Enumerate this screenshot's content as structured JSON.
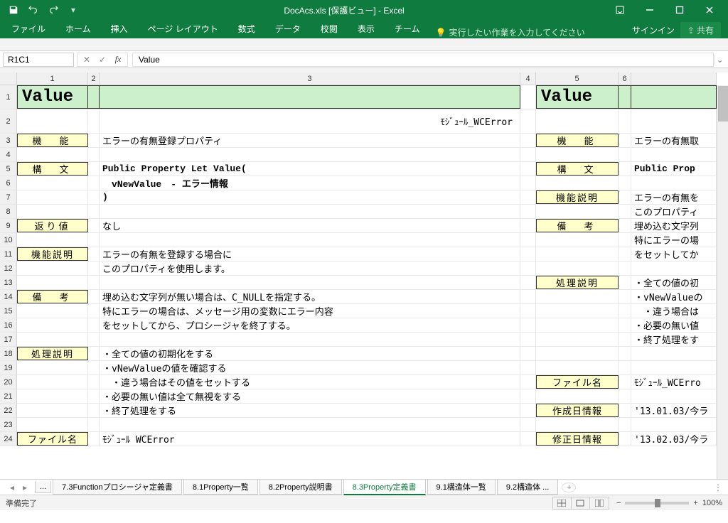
{
  "title": "DocAcs.xls  [保護ビュー] - Excel",
  "ribbon": {
    "tabs": [
      "ファイル",
      "ホーム",
      "挿入",
      "ページ レイアウト",
      "数式",
      "データ",
      "校閲",
      "表示",
      "チーム"
    ],
    "tellme": "実行したい作業を入力してください",
    "signin": "サインイン",
    "share": "共有"
  },
  "formula": {
    "namebox": "R1C1",
    "value": "Value"
  },
  "columns": [
    "1",
    "2",
    "3",
    "4",
    "5",
    "6"
  ],
  "rows": [
    "1",
    "2",
    "3",
    "4",
    "5",
    "6",
    "7",
    "8",
    "9",
    "10",
    "11",
    "12",
    "13",
    "14",
    "15",
    "16",
    "17",
    "18",
    "19",
    "20",
    "21",
    "22",
    "23",
    "24"
  ],
  "left": {
    "header": "Value",
    "module": "ﾓｼﾞｭｰﾙ_WCError",
    "labels": {
      "func": "機　能",
      "syntax": "構　文",
      "return": "返り値",
      "desc": "機能説明",
      "remark": "備　考",
      "process": "処理説明",
      "file": "ファイル名"
    },
    "content": {
      "func": "エラーの有無登録プロパティ",
      "syn1": "Public Property Let Value(",
      "syn2": "　vNewValue　- エラー情報",
      "syn3": ")",
      "ret": "なし",
      "d1": "エラーの有無を登録する場合に",
      "d2": "このプロパティを使用します。",
      "r1": "埋め込む文字列が無い場合は、C_NULLを指定する。",
      "r2": "特にエラーの場合は、メッセージ用の変数にエラー内容",
      "r3": "をセットしてから、プロシージャを終了する。",
      "p1": "・全ての値の初期化をする",
      "p2": "・vNewValueの値を確認する",
      "p3": "　・違う場合はその値をセットする",
      "p4": "・必要の無い値は全て無視をする",
      "p5": "・終了処理をする",
      "file": "ﾓｼﾞｭｰﾙ WCError"
    }
  },
  "right": {
    "header": "Value",
    "labels": {
      "func": "機　能",
      "syntax": "構　文",
      "desc": "機能説明",
      "remark": "備　考",
      "process": "処理説明",
      "file": "ファイル名",
      "create": "作成日情報",
      "modify": "修正日情報"
    },
    "content": {
      "func": "エラーの有無取",
      "syn": "Public Prop",
      "d1": "エラーの有無を",
      "d2": "このプロパティ",
      "r1": "埋め込む文字列",
      "r2": "特にエラーの場",
      "r3": "をセットしてか",
      "p1": "・全ての値の初",
      "p2": "・vNewValueの",
      "p3": "　・違う場合は",
      "p4": "・必要の無い値",
      "p5": "・終了処理をす",
      "file": "ﾓｼﾞｭｰﾙ_WCErro",
      "create": "'13.01.03/今ラ",
      "modify": "'13.02.03/今ラ"
    }
  },
  "sheets": {
    "ellipsis": "...",
    "tabs": [
      "7.3Functionプロシージャ定義書",
      "8.1Property一覧",
      "8.2Property説明書",
      "8.3Property定義書",
      "9.1構造体一覧",
      "9.2構造体 ..."
    ],
    "active_index": 3
  },
  "status": {
    "ready": "準備完了",
    "zoom": "100%"
  }
}
